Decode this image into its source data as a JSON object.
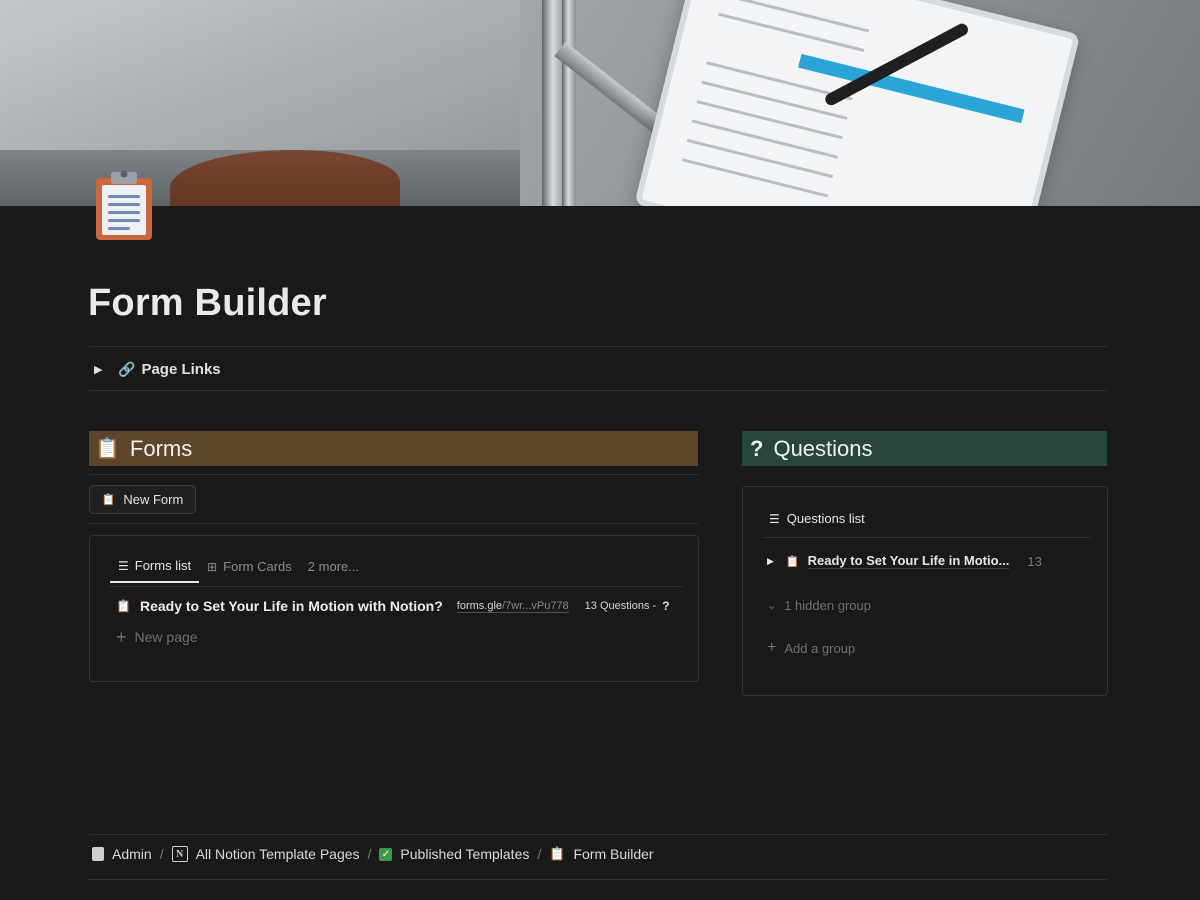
{
  "page": {
    "title": "Form Builder"
  },
  "toggle": {
    "label": "Page Links",
    "icon": "link-icon"
  },
  "forms_section": {
    "heading": "Forms",
    "heading_bg": "#5c452a",
    "new_button": "New Form",
    "tabs": [
      {
        "label": "Forms list",
        "icon": "list-icon",
        "active": true
      },
      {
        "label": "Form Cards",
        "icon": "grid-icon",
        "active": false
      },
      {
        "label": "2 more...",
        "icon": "",
        "active": false
      }
    ],
    "rows": [
      {
        "title": "Ready to Set Your Life in Motion with Notion?",
        "url_start": "forms.gle",
        "url_end": "/7wr...vPu778",
        "questions": "13 Questions -",
        "questions_icon": "?"
      }
    ],
    "new_page": "New page"
  },
  "questions_section": {
    "heading": "Questions",
    "heading_icon": "?",
    "heading_bg": "#28453a",
    "tab": "Questions list",
    "groups": [
      {
        "title": "Ready to Set Your Life in Motio...",
        "count": "13"
      }
    ],
    "hidden_group": "1 hidden group",
    "add_group": "Add a group"
  },
  "breadcrumb": [
    {
      "label": "Admin",
      "icon": "document-icon"
    },
    {
      "label": "All Notion Template Pages",
      "icon": "notion-icon"
    },
    {
      "label": "Published Templates",
      "icon": "checkbox-icon"
    },
    {
      "label": "Form Builder",
      "icon": "clipboard-icon"
    }
  ]
}
